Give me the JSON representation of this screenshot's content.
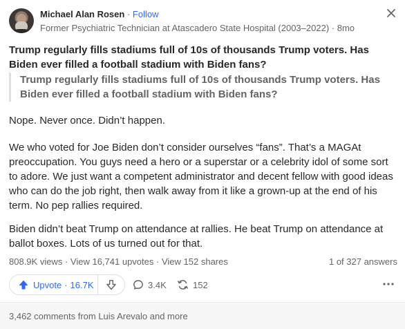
{
  "author": {
    "name": "Michael Alan Rosen",
    "separator": "·",
    "follow_label": "Follow",
    "credential": "Former Psychiatric Technician at Atascadero State Hospital (2003–2022)",
    "time": "8mo"
  },
  "question": {
    "title": "Trump regularly fills stadiums full of 10s of thousands Trump voters. Has Biden ever filled a football stadium with Biden fans?",
    "quote": "Trump regularly fills stadiums full of 10s of thousands Trump voters. Has Biden ever filled a football stadium with Biden fans?"
  },
  "answer": {
    "paragraphs": [
      "Nope. Never once. Didn’t happen.",
      "We who voted for Joe Biden don’t consider ourselves “fans”. That’s a MAGAt preoccupation. You guys need a hero or a superstar or a celebrity idol of some sort to adore. We just want a competent administrator and decent fellow with good ideas who can do the job right, then walk away from it like a grown-up at the end of his term. No pep rallies required.",
      "Biden didn’t beat Trump on attendance at rallies. He beat Trump on attendance at ballot boxes. Lots of us turned out for that."
    ]
  },
  "stats": {
    "views": "808.9K views",
    "upvotes_link": "View 16,741 upvotes",
    "shares_link": "View 152 shares",
    "answer_position": "1 of 327 answers"
  },
  "actions": {
    "upvote_label": "Upvote",
    "upvote_count": "16.7K",
    "comments_count": "3.4K",
    "shares_count": "152"
  },
  "footer": {
    "comments_text": "3,462 comments from Luis Arevalo and more"
  },
  "colors": {
    "accent": "#2e69ff",
    "text": "#282829",
    "muted": "#636466",
    "footer_bg": "#f7f7f8"
  },
  "icons": [
    "close-icon",
    "upvote-arrow-icon",
    "downvote-arrow-icon",
    "comment-icon",
    "share-icon",
    "more-icon"
  ]
}
